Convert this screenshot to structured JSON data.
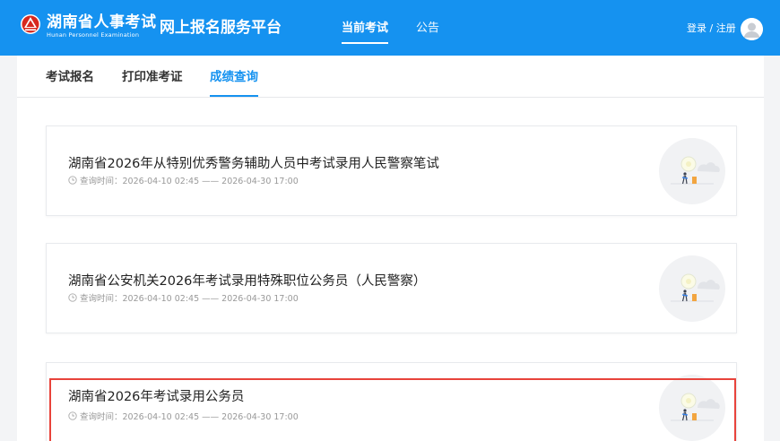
{
  "header": {
    "org_name": "湖南省人事考试",
    "org_name_en": "Hunan Personnel Examination",
    "platform_title": "网上报名服务平台",
    "nav": [
      {
        "label": "当前考试",
        "active": true
      },
      {
        "label": "公告",
        "active": false
      }
    ],
    "login_label": "登录 / 注册"
  },
  "subtabs": [
    {
      "label": "考试报名",
      "active": false
    },
    {
      "label": "打印准考证",
      "active": false
    },
    {
      "label": "成绩查询",
      "active": true
    }
  ],
  "cards": [
    {
      "title": "湖南省2026年从特别优秀警务辅助人员中考试录用人民警察笔试",
      "time_label": "查询时间：",
      "time_range": "2026-04-10 02:45 —— 2026-04-30 17:00",
      "highlighted": false
    },
    {
      "title": "湖南省公安机关2026年考试录用特殊职位公务员（人民警察）",
      "time_label": "查询时间：",
      "time_range": "2026-04-10 02:45 —— 2026-04-30 17:00",
      "highlighted": false
    },
    {
      "title": "湖南省2026年考试录用公务员",
      "time_label": "查询时间：",
      "time_range": "2026-04-10 02:45 —— 2026-04-30 17:00",
      "highlighted": true
    }
  ],
  "colors": {
    "header_bg": "#1592f0",
    "accent": "#1592f0",
    "highlight_border": "#e8433b",
    "logo_red": "#d7281e"
  },
  "icons": [
    "site-logo-icon",
    "user-avatar-icon",
    "clock-icon",
    "exam-illustration-icon"
  ]
}
